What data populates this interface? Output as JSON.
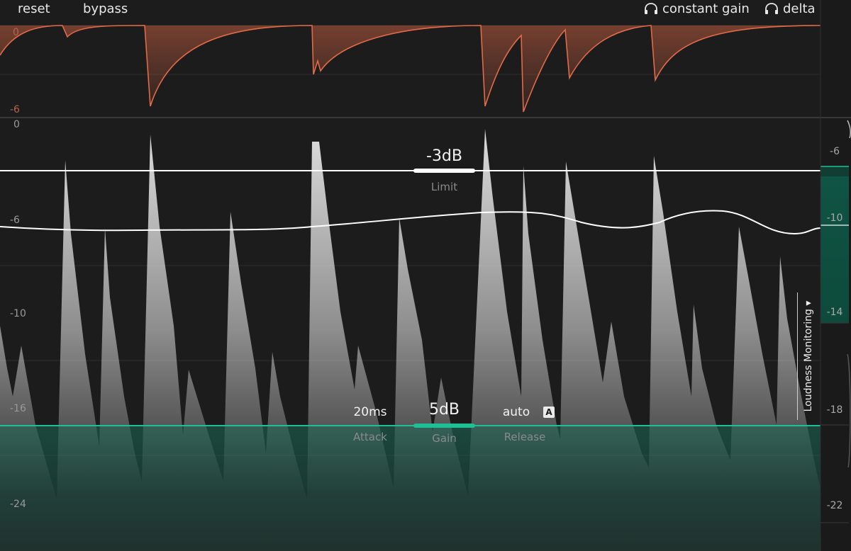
{
  "toolbar": {
    "reset_label": "reset",
    "bypass_label": "bypass",
    "constant_gain_label": "constant gain",
    "delta_label": "delta"
  },
  "gain_reduction_meter": {
    "axis_labels": [
      "0",
      "-6"
    ]
  },
  "main_graph": {
    "axis_labels": [
      "0",
      "-6",
      "-10",
      "-16",
      "-24"
    ]
  },
  "right_meter": {
    "axis_labels": [
      "-6",
      "-10",
      "-14",
      "-18",
      "-22"
    ]
  },
  "controls": {
    "limit": {
      "value": "-3dB",
      "label": "Limit"
    },
    "gain": {
      "value": "5dB",
      "label": "Gain"
    },
    "attack": {
      "value": "20ms",
      "label": "Attack"
    },
    "release": {
      "value": "auto",
      "label": "Release",
      "auto_badge": "A"
    }
  },
  "loudness_monitoring": {
    "label": "Loudness Monitoring ▾"
  },
  "colors": {
    "accent_teal": "#1fbf95",
    "gain_reduction_orange": "#e26a47",
    "background": "#1c1c1c"
  }
}
